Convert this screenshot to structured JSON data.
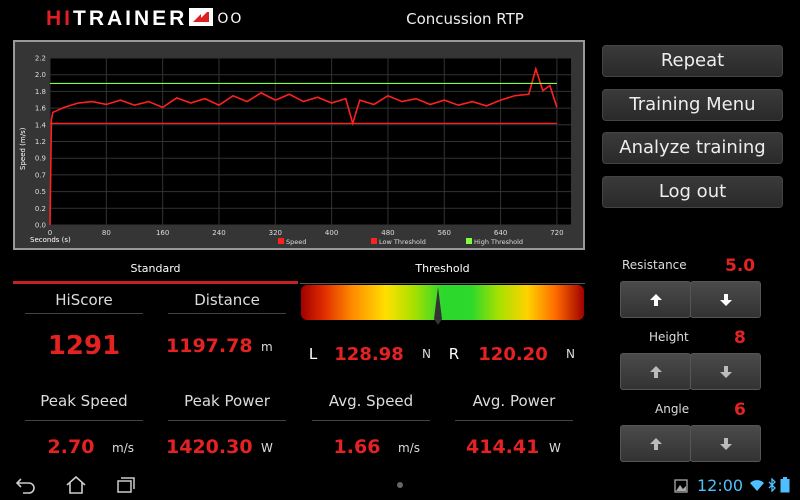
{
  "app": {
    "logo_hi": "HI",
    "logo_trainer": "TRAINER",
    "logo_rings": "OO",
    "title": "Concussion RTP"
  },
  "buttons": {
    "repeat": "Repeat",
    "training_menu": "Training Menu",
    "analyze": "Analyze training",
    "logout": "Log out"
  },
  "tabs": {
    "standard": "Standard",
    "threshold": "Threshold"
  },
  "stats": {
    "hiscore_label": "HiScore",
    "hiscore_value": "1291",
    "distance_label": "Distance",
    "distance_value": "1197.78",
    "distance_unit": "m",
    "peak_speed_label": "Peak Speed",
    "peak_speed_value": "2.70",
    "peak_speed_unit": "m/s",
    "peak_power_label": "Peak Power",
    "peak_power_value": "1420.30",
    "peak_power_unit": "W",
    "avg_speed_label": "Avg. Speed",
    "avg_speed_value": "1.66",
    "avg_speed_unit": "m/s",
    "avg_power_label": "Avg. Power",
    "avg_power_value": "414.41",
    "avg_power_unit": "W"
  },
  "threshold": {
    "left_label": "L",
    "left_value": "128.98",
    "left_unit": "N",
    "right_label": "R",
    "right_value": "120.20",
    "right_unit": "N"
  },
  "controls": {
    "resistance_label": "Resistance",
    "resistance_value": "5.0",
    "height_label": "Height",
    "height_value": "8",
    "angle_label": "Angle",
    "angle_value": "6"
  },
  "status_bar": {
    "clock": "12:00"
  },
  "colors": {
    "accent_red": "#e52222",
    "speed_line": "#ff2020",
    "low_threshold": "#ff2020",
    "high_threshold": "#7fff3f",
    "clock_blue": "#4fc0ff"
  },
  "icons": [
    "back-icon",
    "home-icon",
    "recent-apps-icon",
    "image-icon",
    "wifi-icon",
    "bluetooth-icon",
    "battery-icon",
    "arrow-up-icon",
    "arrow-down-icon"
  ],
  "chart_data": {
    "type": "line",
    "xlabel": "Seconds (s)",
    "ylabel": "Speed (m/s)",
    "xlim": [
      0,
      740
    ],
    "ylim": [
      0,
      2.3
    ],
    "xticks": [
      0,
      80,
      160,
      240,
      320,
      400,
      480,
      560,
      640,
      720
    ],
    "yticks": [
      "0.0",
      "0.2",
      "0.5",
      "0.7",
      "0.9",
      "1.2",
      "1.4",
      "1.6",
      "1.8",
      "2.0",
      "2.2"
    ],
    "ytick_values": [
      0.0,
      0.23,
      0.46,
      0.69,
      0.92,
      1.15,
      1.38,
      1.61,
      1.84,
      2.07,
      2.3
    ],
    "grid": true,
    "legend_position": "bottom",
    "series": [
      {
        "name": "Speed",
        "color": "#ff2020",
        "x": [
          0,
          2,
          4,
          20,
          40,
          60,
          80,
          100,
          120,
          140,
          160,
          180,
          200,
          220,
          240,
          260,
          280,
          300,
          320,
          340,
          360,
          380,
          400,
          420,
          430,
          440,
          460,
          480,
          500,
          520,
          540,
          560,
          580,
          600,
          620,
          640,
          660,
          680,
          690,
          700,
          710,
          720
        ],
        "y": [
          0.0,
          1.45,
          1.55,
          1.62,
          1.68,
          1.7,
          1.66,
          1.72,
          1.65,
          1.7,
          1.62,
          1.75,
          1.68,
          1.74,
          1.65,
          1.78,
          1.7,
          1.82,
          1.72,
          1.8,
          1.7,
          1.76,
          1.68,
          1.74,
          1.4,
          1.72,
          1.66,
          1.78,
          1.7,
          1.74,
          1.66,
          1.72,
          1.65,
          1.7,
          1.64,
          1.72,
          1.78,
          1.8,
          2.15,
          1.85,
          1.92,
          1.62
        ]
      },
      {
        "name": "Low Threshold",
        "color": "#ff2020",
        "x": [
          0,
          720
        ],
        "y": [
          1.4,
          1.4
        ]
      },
      {
        "name": "High Threshold",
        "color": "#7fff3f",
        "x": [
          0,
          720
        ],
        "y": [
          1.95,
          1.95
        ]
      }
    ]
  }
}
